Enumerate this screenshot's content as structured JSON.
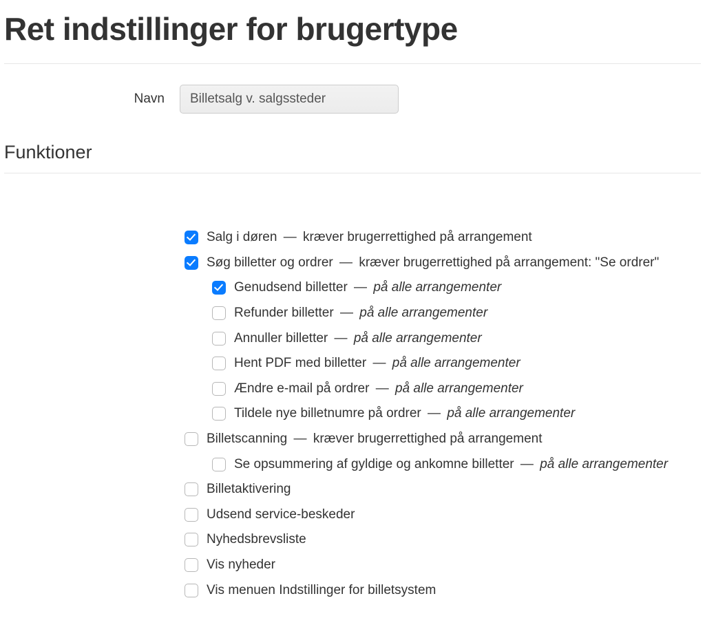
{
  "page_title": "Ret indstillinger for brugertype",
  "name_label": "Navn",
  "name_value": "Billetsalg v. salgssteder",
  "functions_heading": "Funktioner",
  "dash": " — ",
  "suffix_all_events": "på alle arrangementer",
  "items": {
    "door_sales": {
      "label": "Salg i døren",
      "suffix": "kræver brugerrettighed på arrangement",
      "checked": true
    },
    "search_orders": {
      "label": "Søg billetter og ordrer",
      "suffix": "kræver brugerrettighed på arrangement: \"Se ordrer\"",
      "checked": true
    },
    "resend_tickets": {
      "label": "Genudsend billetter",
      "checked": true
    },
    "refund_tickets": {
      "label": "Refunder billetter",
      "checked": false
    },
    "cancel_tickets": {
      "label": "Annuller billetter",
      "checked": false
    },
    "download_pdf": {
      "label": "Hent PDF med billetter",
      "checked": false
    },
    "change_email": {
      "label": "Ændre e-mail på ordrer",
      "checked": false
    },
    "assign_numbers": {
      "label": "Tildele nye billetnumre på ordrer",
      "checked": false
    },
    "ticket_scanning": {
      "label": "Billetscanning",
      "suffix": "kræver brugerrettighed på arrangement",
      "checked": false
    },
    "summary_valid": {
      "label": "Se opsummering af gyldige og ankomne billetter",
      "checked": false
    },
    "ticket_activation": {
      "label": "Billetaktivering",
      "checked": false
    },
    "service_messages": {
      "label": "Udsend service-beskeder",
      "checked": false
    },
    "newsletter_list": {
      "label": "Nyhedsbrevsliste",
      "checked": false
    },
    "show_news": {
      "label": "Vis nyheder",
      "checked": false
    },
    "show_settings_menu": {
      "label": "Vis menuen Indstillinger for billetsystem",
      "checked": false
    }
  }
}
